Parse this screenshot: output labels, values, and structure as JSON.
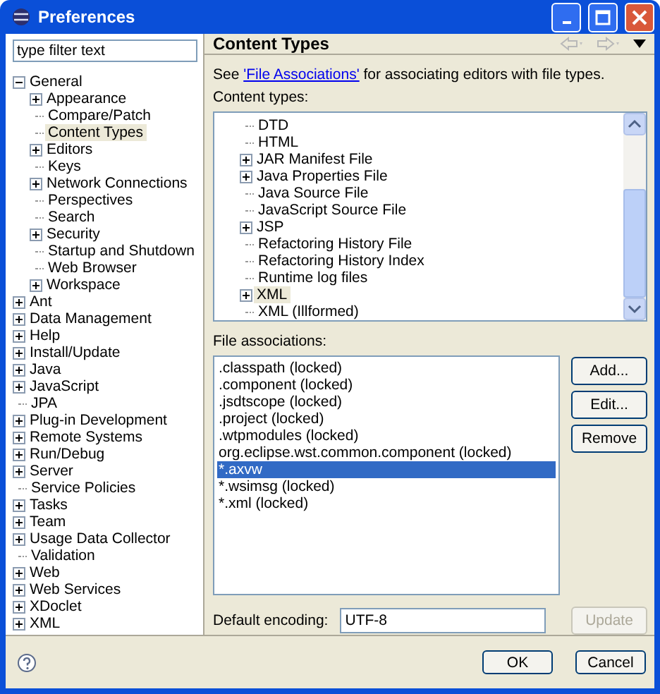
{
  "window": {
    "title": "Preferences"
  },
  "filter": {
    "value": "type filter text"
  },
  "nav_tree": [
    {
      "label": "General",
      "expanded": true,
      "selected": false,
      "children": [
        {
          "label": "Appearance",
          "expanded": false,
          "selected": false
        },
        {
          "label": "Compare/Patch",
          "selected": false
        },
        {
          "label": "Content Types",
          "selected": true
        },
        {
          "label": "Editors",
          "expanded": false,
          "selected": false
        },
        {
          "label": "Keys",
          "selected": false
        },
        {
          "label": "Network Connections",
          "expanded": false,
          "selected": false
        },
        {
          "label": "Perspectives",
          "selected": false
        },
        {
          "label": "Search",
          "selected": false
        },
        {
          "label": "Security",
          "expanded": false,
          "selected": false
        },
        {
          "label": "Startup and Shutdown",
          "selected": false
        },
        {
          "label": "Web Browser",
          "selected": false
        },
        {
          "label": "Workspace",
          "expanded": false,
          "selected": false
        }
      ]
    },
    {
      "label": "Ant",
      "expanded": false,
      "selected": false
    },
    {
      "label": "Data Management",
      "expanded": false,
      "selected": false
    },
    {
      "label": "Help",
      "expanded": false,
      "selected": false
    },
    {
      "label": "Install/Update",
      "expanded": false,
      "selected": false
    },
    {
      "label": "Java",
      "expanded": false,
      "selected": false
    },
    {
      "label": "JavaScript",
      "expanded": false,
      "selected": false
    },
    {
      "label": "JPA",
      "selected": false
    },
    {
      "label": "Plug-in Development",
      "expanded": false,
      "selected": false
    },
    {
      "label": "Remote Systems",
      "expanded": false,
      "selected": false
    },
    {
      "label": "Run/Debug",
      "expanded": false,
      "selected": false
    },
    {
      "label": "Server",
      "expanded": false,
      "selected": false
    },
    {
      "label": "Service Policies",
      "selected": false
    },
    {
      "label": "Tasks",
      "expanded": false,
      "selected": false
    },
    {
      "label": "Team",
      "expanded": false,
      "selected": false
    },
    {
      "label": "Usage Data Collector",
      "expanded": false,
      "selected": false
    },
    {
      "label": "Validation",
      "selected": false
    },
    {
      "label": "Web",
      "expanded": false,
      "selected": false
    },
    {
      "label": "Web Services",
      "expanded": false,
      "selected": false
    },
    {
      "label": "XDoclet",
      "expanded": false,
      "selected": false
    },
    {
      "label": "XML",
      "expanded": false,
      "selected": false
    }
  ],
  "page": {
    "title": "Content Types",
    "intro": {
      "before": "See ",
      "link": "'File Associations'",
      "after": " for associating editors with file types."
    },
    "content_types_label": "Content types:",
    "content_types": [
      {
        "label": "DTD",
        "selected": false
      },
      {
        "label": "HTML",
        "selected": false
      },
      {
        "label": "JAR Manifest File",
        "expanded": false,
        "selected": false
      },
      {
        "label": "Java Properties File",
        "expanded": false,
        "selected": false
      },
      {
        "label": "Java Source File",
        "selected": false
      },
      {
        "label": "JavaScript Source File",
        "selected": false
      },
      {
        "label": "JSP",
        "expanded": false,
        "selected": false
      },
      {
        "label": "Refactoring History File",
        "selected": false
      },
      {
        "label": "Refactoring History Index",
        "selected": false
      },
      {
        "label": "Runtime log files",
        "selected": false
      },
      {
        "label": "XML",
        "expanded": false,
        "selected": true
      },
      {
        "label": "XML (Illformed)",
        "selected": false
      }
    ],
    "file_associations_label": "File associations:",
    "file_associations": [
      {
        "label": ".classpath (locked)",
        "selected": false
      },
      {
        "label": ".component (locked)",
        "selected": false
      },
      {
        "label": ".jsdtscope (locked)",
        "selected": false
      },
      {
        "label": ".project (locked)",
        "selected": false
      },
      {
        "label": ".wtpmodules (locked)",
        "selected": false
      },
      {
        "label": "org.eclipse.wst.common.component (locked)",
        "selected": false
      },
      {
        "label": "*.axvw",
        "selected": true
      },
      {
        "label": "*.wsimsg (locked)",
        "selected": false
      },
      {
        "label": "*.xml (locked)",
        "selected": false
      }
    ],
    "association_buttons": [
      {
        "label": "Add...",
        "disabled": false
      },
      {
        "label": "Edit...",
        "disabled": false
      },
      {
        "label": "Remove",
        "disabled": false
      }
    ],
    "encoding": {
      "label": "Default encoding:",
      "value": "UTF-8",
      "button": {
        "label": "Update",
        "disabled": true
      }
    }
  },
  "dialog_buttons": [
    "OK",
    "Cancel"
  ]
}
